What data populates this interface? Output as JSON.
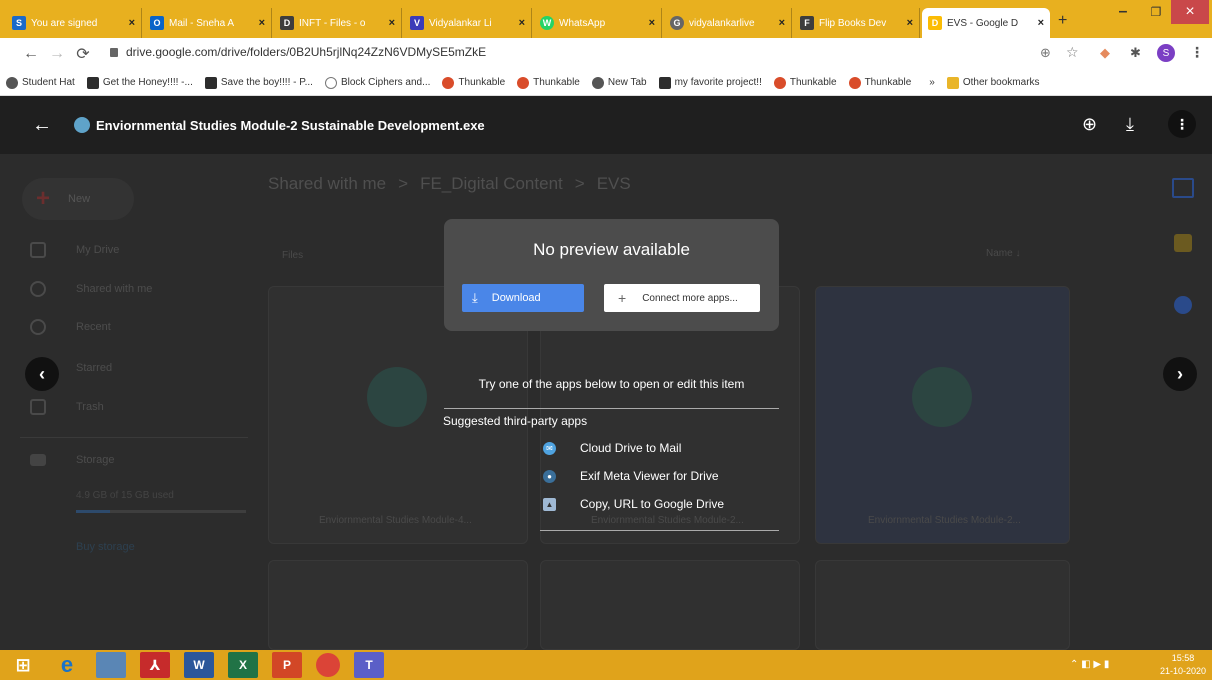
{
  "tabs": [
    {
      "label": "You are signed",
      "favicon": "S",
      "color": "#1b6ac9"
    },
    {
      "label": "Mail - Sneha A",
      "favicon": "O",
      "color": "#0a64c8"
    },
    {
      "label": "INFT - Files - o",
      "favicon": "D",
      "color": "#3d3d3d"
    },
    {
      "label": "Vidyalankar Li",
      "favicon": "V",
      "color": "#3b3bb8"
    },
    {
      "label": "WhatsApp",
      "favicon": "W",
      "color": "#25d366"
    },
    {
      "label": "vidyalankarlive",
      "favicon": "G",
      "color": "#666"
    },
    {
      "label": "Flip Books Dev",
      "favicon": "F",
      "color": "#3d3d3d"
    },
    {
      "label": "EVS - Google D",
      "favicon": "D",
      "color": "#fbbc04"
    }
  ],
  "url": "drive.google.com/drive/folders/0B2Uh5rjlNq24ZzN6VDMySE5mZkE",
  "bookmarks": [
    "Student Hat",
    "Get the Honey!!!! -...",
    "Save the boy!!!! - P...",
    "Block Ciphers and...",
    "Thunkable",
    "Thunkable",
    "New Tab",
    "my favorite project!!",
    "Thunkable",
    "Thunkable",
    "Other bookmarks"
  ],
  "viewer": {
    "title": "Enviornmental Studies Module-2 Sustainable Development.exe"
  },
  "drive": {
    "new_label": "New",
    "breadcrumb": [
      "Shared with me",
      ">",
      "FE_Digital Content",
      ">",
      "EVS"
    ],
    "sidebar": [
      "My Drive",
      "Shared with me",
      "Recent",
      "Starred",
      "Trash"
    ],
    "storage_label": "Storage",
    "storage_used": "4.9 GB of 15 GB used",
    "buy_storage": "Buy storage",
    "files_label": "Files",
    "sort_label": "Name",
    "cards": [
      "Enviornmental Studies Module-4...",
      "Enviornmental Studies Module-2...",
      "Enviornmental Studies Module-2..."
    ]
  },
  "dialog": {
    "title": "No preview available",
    "download_label": "Download",
    "connect_label": "Connect more apps..."
  },
  "suggestions": {
    "try_text": "Try one of the apps below to open or edit this item",
    "label": "Suggested third-party apps",
    "apps": [
      "Cloud Drive to Mail",
      "Exif Meta Viewer for Drive",
      "Copy, URL to Google Drive"
    ]
  },
  "clock": {
    "time": "15:58",
    "date": "21-10-2020"
  },
  "colors": {
    "accent": "#4a86e8",
    "taskbar": "#e0a31b",
    "tabbar": "#e8b01f"
  }
}
